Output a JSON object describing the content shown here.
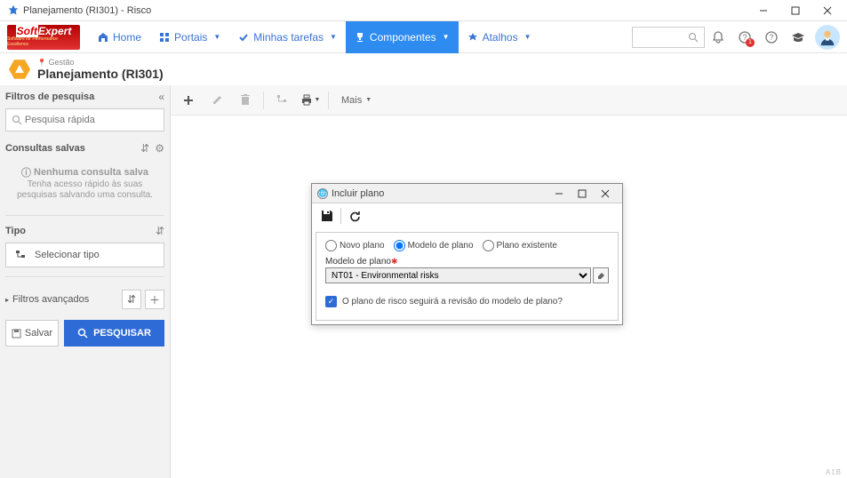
{
  "window": {
    "title": "Planejamento (RI301) - Risco"
  },
  "nav": {
    "home": "Home",
    "portais": "Portais",
    "tarefas": "Minhas tarefas",
    "componentes": "Componentes",
    "atalhos": "Atalhos",
    "help_badge": "1"
  },
  "logo": {
    "top": "SoftExpert",
    "sub": "Software for Performance Excellence"
  },
  "page": {
    "breadcrumb": "Gestão",
    "title": "Planejamento (RI301)"
  },
  "sidebar": {
    "filters_title": "Filtros de pesquisa",
    "search_placeholder": "Pesquisa rápida",
    "saved_title": "Consultas salvas",
    "saved_none_h": "Nenhuma consulta salva",
    "saved_none_s": "Tenha acesso rápido às suas pesquisas salvando uma consulta.",
    "type_label": "Tipo",
    "type_btn": "Selecionar tipo",
    "adv": "Filtros avançados",
    "save": "Salvar",
    "search": "PESQUISAR"
  },
  "toolbar": {
    "more": "Mais"
  },
  "modal": {
    "title": "Incluir plano",
    "r_new": "Novo plano",
    "r_model": "Modelo de plano",
    "r_exist": "Plano existente",
    "field_label": "Modelo de plano",
    "select_value": "NT01 - Environmental risks",
    "checkbox_label": "O plano de risco seguirá a revisão do modelo de plano?"
  },
  "corner": "A1B"
}
